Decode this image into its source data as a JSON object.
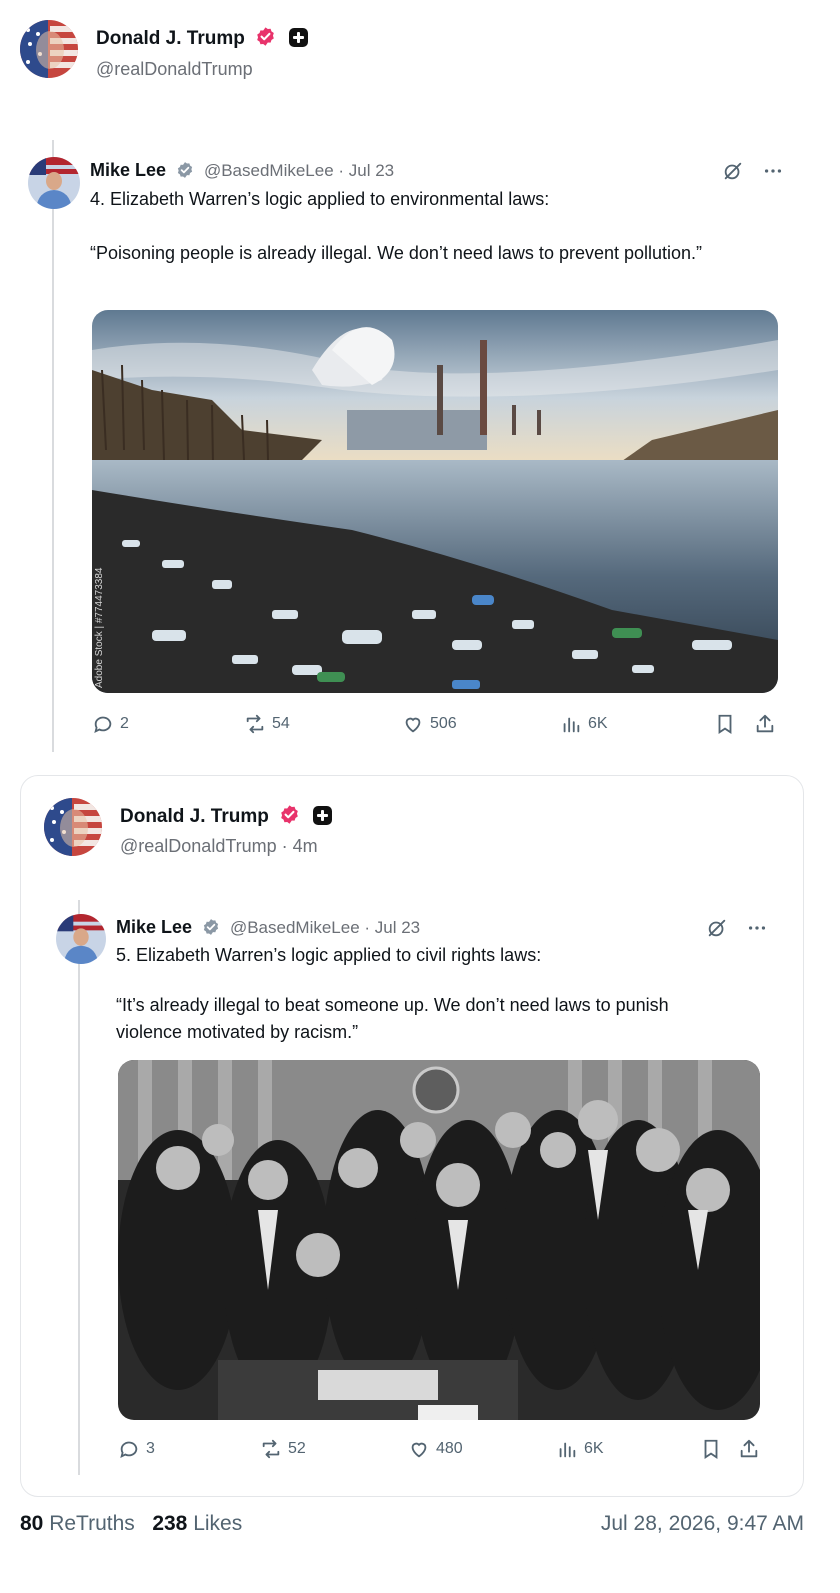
{
  "post": {
    "author_name": "Donald J. Trump",
    "author_handle": "@realDonaldTrump"
  },
  "quote1": {
    "author_name": "Mike Lee",
    "author_handle": "@BasedMikeLee · Jul 23",
    "line1": "4. Elizabeth Warren’s logic applied to environmental laws:",
    "line2": "“Poisoning people is already illegal. We don’t need laws to prevent pollution.”",
    "media_watermark": "Adobe Stock | #774473384",
    "stats": {
      "replies": "2",
      "retruths": "54",
      "likes": "506",
      "views": "6K"
    }
  },
  "repost": {
    "author_name": "Donald J. Trump",
    "author_handle": "@realDonaldTrump · 4m"
  },
  "quote2": {
    "author_name": "Mike Lee",
    "author_handle": "@BasedMikeLee · Jul 23",
    "line1": "5. Elizabeth Warren’s logic applied to civil rights laws:",
    "line2": "“It’s already illegal to beat someone up. We don’t need laws to punish violence motivated by racism.”",
    "stats": {
      "replies": "3",
      "retruths": "52",
      "likes": "480",
      "views": "6K"
    }
  },
  "footer": {
    "retruths_count": "80",
    "retruths_label": "ReTruths",
    "likes_count": "238",
    "likes_label": "Likes",
    "timestamp": "Jul 28, 2026, 9:47 AM"
  },
  "icons": {
    "reply": "comment-icon",
    "retruth": "retruth-icon",
    "like": "heart-icon",
    "views": "views-icon",
    "bookmark": "bookmark-icon",
    "share": "share-icon",
    "grok": "grok-icon",
    "more": "more-icon"
  },
  "colors": {
    "verified_badge": "#e8336b",
    "text_secondary": "#536471"
  }
}
